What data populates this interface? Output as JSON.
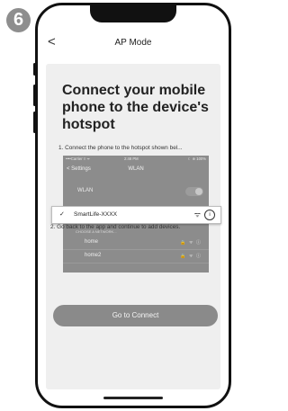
{
  "step_number": "6",
  "nav": {
    "back": "<",
    "title": "AP Mode"
  },
  "main": {
    "heading": "Connect your mobile phone to the device's hotspot",
    "step1": "1. Connect the phone to the hotspot shown bel...",
    "step2": "2. Go back to the app and continue to add devices.",
    "connect_button": "Go to Connect"
  },
  "screenshot": {
    "status": {
      "carrier": "••••Carrier ≡ ᯤ",
      "time": "2:48 PM",
      "battery": "☾ ⊕ 100%"
    },
    "nav": {
      "back": "< Settings",
      "title": "WLAN"
    },
    "wlan_label": "WLAN",
    "selected_network": "SmartLife-XXXX",
    "choose_label": "CHOOSE A NETWORK...",
    "networks": [
      {
        "name": "home",
        "icons": "🔒 ᯤ ⓘ"
      },
      {
        "name": "home2",
        "icons": "🔒 ᯤ ⓘ"
      }
    ],
    "icons": {
      "check": "✓",
      "wifi": "ᯤ",
      "info": "i"
    }
  }
}
